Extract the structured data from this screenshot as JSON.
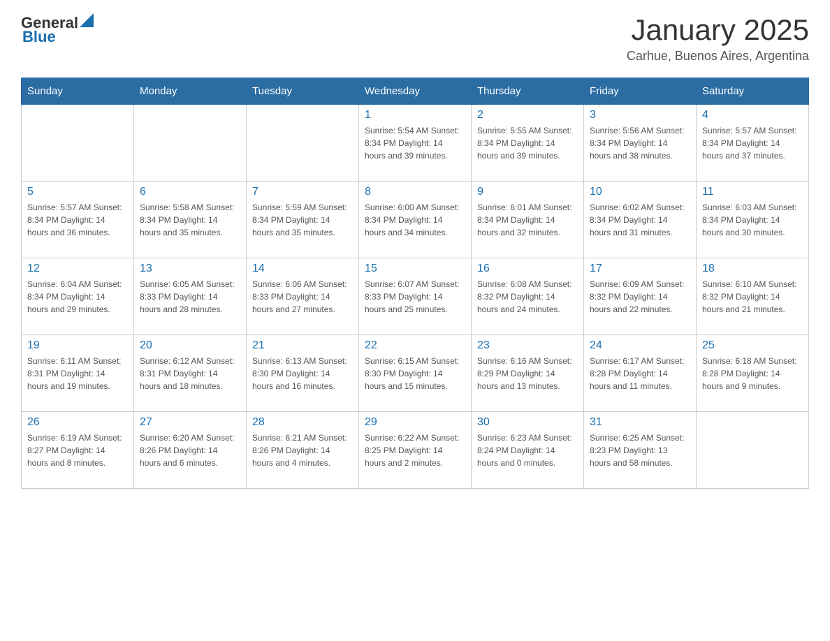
{
  "header": {
    "logo_general": "General",
    "logo_blue": "Blue",
    "title": "January 2025",
    "subtitle": "Carhue, Buenos Aires, Argentina"
  },
  "days_of_week": [
    "Sunday",
    "Monday",
    "Tuesday",
    "Wednesday",
    "Thursday",
    "Friday",
    "Saturday"
  ],
  "weeks": [
    [
      {
        "day": "",
        "info": ""
      },
      {
        "day": "",
        "info": ""
      },
      {
        "day": "",
        "info": ""
      },
      {
        "day": "1",
        "info": "Sunrise: 5:54 AM\nSunset: 8:34 PM\nDaylight: 14 hours\nand 39 minutes."
      },
      {
        "day": "2",
        "info": "Sunrise: 5:55 AM\nSunset: 8:34 PM\nDaylight: 14 hours\nand 39 minutes."
      },
      {
        "day": "3",
        "info": "Sunrise: 5:56 AM\nSunset: 8:34 PM\nDaylight: 14 hours\nand 38 minutes."
      },
      {
        "day": "4",
        "info": "Sunrise: 5:57 AM\nSunset: 8:34 PM\nDaylight: 14 hours\nand 37 minutes."
      }
    ],
    [
      {
        "day": "5",
        "info": "Sunrise: 5:57 AM\nSunset: 8:34 PM\nDaylight: 14 hours\nand 36 minutes."
      },
      {
        "day": "6",
        "info": "Sunrise: 5:58 AM\nSunset: 8:34 PM\nDaylight: 14 hours\nand 35 minutes."
      },
      {
        "day": "7",
        "info": "Sunrise: 5:59 AM\nSunset: 8:34 PM\nDaylight: 14 hours\nand 35 minutes."
      },
      {
        "day": "8",
        "info": "Sunrise: 6:00 AM\nSunset: 8:34 PM\nDaylight: 14 hours\nand 34 minutes."
      },
      {
        "day": "9",
        "info": "Sunrise: 6:01 AM\nSunset: 8:34 PM\nDaylight: 14 hours\nand 32 minutes."
      },
      {
        "day": "10",
        "info": "Sunrise: 6:02 AM\nSunset: 8:34 PM\nDaylight: 14 hours\nand 31 minutes."
      },
      {
        "day": "11",
        "info": "Sunrise: 6:03 AM\nSunset: 8:34 PM\nDaylight: 14 hours\nand 30 minutes."
      }
    ],
    [
      {
        "day": "12",
        "info": "Sunrise: 6:04 AM\nSunset: 8:34 PM\nDaylight: 14 hours\nand 29 minutes."
      },
      {
        "day": "13",
        "info": "Sunrise: 6:05 AM\nSunset: 8:33 PM\nDaylight: 14 hours\nand 28 minutes."
      },
      {
        "day": "14",
        "info": "Sunrise: 6:06 AM\nSunset: 8:33 PM\nDaylight: 14 hours\nand 27 minutes."
      },
      {
        "day": "15",
        "info": "Sunrise: 6:07 AM\nSunset: 8:33 PM\nDaylight: 14 hours\nand 25 minutes."
      },
      {
        "day": "16",
        "info": "Sunrise: 6:08 AM\nSunset: 8:32 PM\nDaylight: 14 hours\nand 24 minutes."
      },
      {
        "day": "17",
        "info": "Sunrise: 6:09 AM\nSunset: 8:32 PM\nDaylight: 14 hours\nand 22 minutes."
      },
      {
        "day": "18",
        "info": "Sunrise: 6:10 AM\nSunset: 8:32 PM\nDaylight: 14 hours\nand 21 minutes."
      }
    ],
    [
      {
        "day": "19",
        "info": "Sunrise: 6:11 AM\nSunset: 8:31 PM\nDaylight: 14 hours\nand 19 minutes."
      },
      {
        "day": "20",
        "info": "Sunrise: 6:12 AM\nSunset: 8:31 PM\nDaylight: 14 hours\nand 18 minutes."
      },
      {
        "day": "21",
        "info": "Sunrise: 6:13 AM\nSunset: 8:30 PM\nDaylight: 14 hours\nand 16 minutes."
      },
      {
        "day": "22",
        "info": "Sunrise: 6:15 AM\nSunset: 8:30 PM\nDaylight: 14 hours\nand 15 minutes."
      },
      {
        "day": "23",
        "info": "Sunrise: 6:16 AM\nSunset: 8:29 PM\nDaylight: 14 hours\nand 13 minutes."
      },
      {
        "day": "24",
        "info": "Sunrise: 6:17 AM\nSunset: 8:28 PM\nDaylight: 14 hours\nand 11 minutes."
      },
      {
        "day": "25",
        "info": "Sunrise: 6:18 AM\nSunset: 8:28 PM\nDaylight: 14 hours\nand 9 minutes."
      }
    ],
    [
      {
        "day": "26",
        "info": "Sunrise: 6:19 AM\nSunset: 8:27 PM\nDaylight: 14 hours\nand 8 minutes."
      },
      {
        "day": "27",
        "info": "Sunrise: 6:20 AM\nSunset: 8:26 PM\nDaylight: 14 hours\nand 6 minutes."
      },
      {
        "day": "28",
        "info": "Sunrise: 6:21 AM\nSunset: 8:26 PM\nDaylight: 14 hours\nand 4 minutes."
      },
      {
        "day": "29",
        "info": "Sunrise: 6:22 AM\nSunset: 8:25 PM\nDaylight: 14 hours\nand 2 minutes."
      },
      {
        "day": "30",
        "info": "Sunrise: 6:23 AM\nSunset: 8:24 PM\nDaylight: 14 hours\nand 0 minutes."
      },
      {
        "day": "31",
        "info": "Sunrise: 6:25 AM\nSunset: 8:23 PM\nDaylight: 13 hours\nand 58 minutes."
      },
      {
        "day": "",
        "info": ""
      }
    ]
  ]
}
